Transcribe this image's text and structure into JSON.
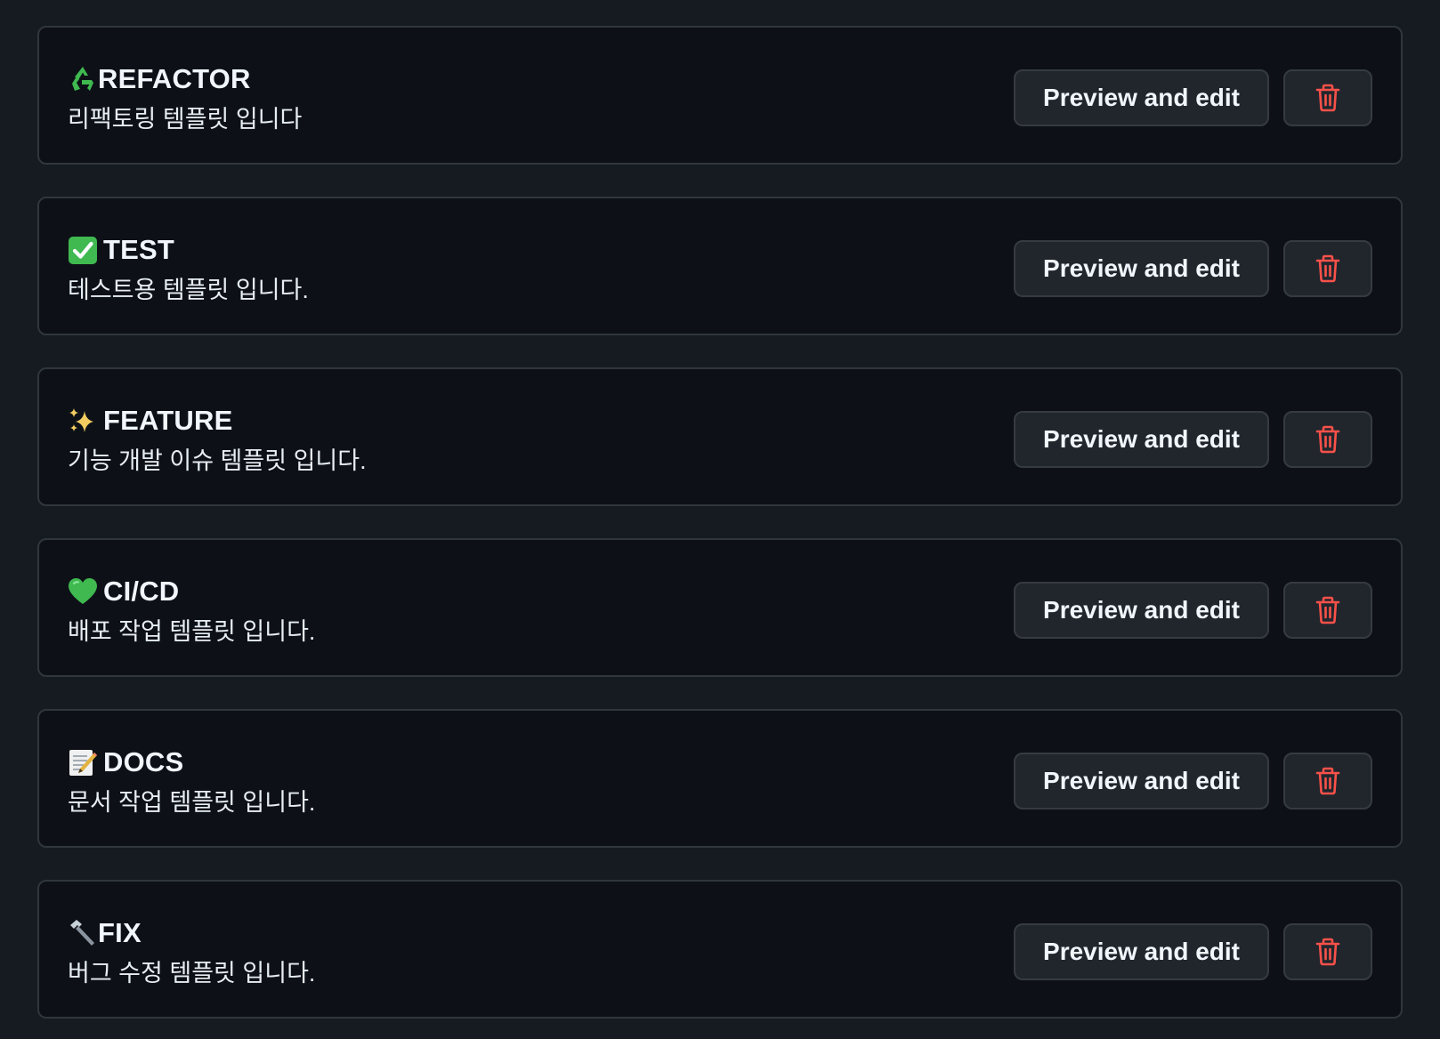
{
  "colors": {
    "page_background": "#161b22",
    "card_background": "#0d1117",
    "card_border": "#30363d",
    "button_background": "#21262d",
    "danger": "#f85149",
    "text": "#e6edf3"
  },
  "templates": [
    {
      "icon": "recycle-icon",
      "title": "REFACTOR",
      "description": "리팩토링 템플릿 입니다",
      "preview_label": "Preview and edit",
      "delete_icon": "trash-icon"
    },
    {
      "icon": "check-mark-icon",
      "title": "TEST",
      "description": "테스트용 템플릿 입니다.",
      "preview_label": "Preview and edit",
      "delete_icon": "trash-icon"
    },
    {
      "icon": "sparkles-icon",
      "title": "FEATURE",
      "description": "기능 개발 이슈 템플릿 입니다.",
      "preview_label": "Preview and edit",
      "delete_icon": "trash-icon"
    },
    {
      "icon": "green-heart-icon",
      "title": "CI/CD",
      "description": "배포 작업 템플릿 입니다.",
      "preview_label": "Preview and edit",
      "delete_icon": "trash-icon"
    },
    {
      "icon": "memo-icon",
      "title": "DOCS",
      "description": "문서 작업 템플릿 입니다.",
      "preview_label": "Preview and edit",
      "delete_icon": "trash-icon"
    },
    {
      "icon": "hammer-icon",
      "title": "FIX",
      "description": "버그 수정 템플릿 입니다.",
      "preview_label": "Preview and edit",
      "delete_icon": "trash-icon"
    }
  ]
}
